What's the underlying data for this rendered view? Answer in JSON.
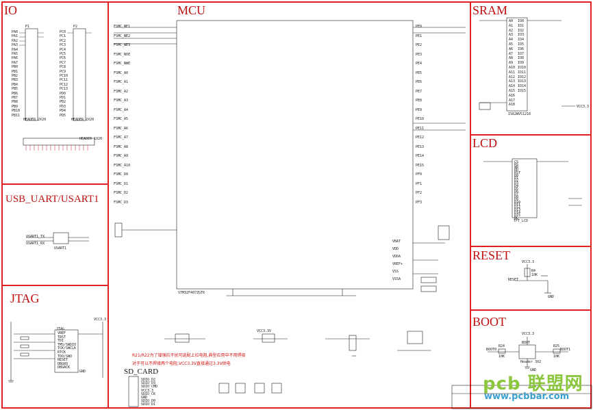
{
  "panels": {
    "io": "IO",
    "usb_uart": "USB_UART/USART1",
    "jtag": "JTAG",
    "mcu": "MCU",
    "sram": "SRAM",
    "lcd": "LCD",
    "reset": "RESET",
    "boot": "BOOT",
    "sd_card": "SD_CARD"
  },
  "io": {
    "header_left": "HEADER 2X20",
    "header_right": "HEADER 2X20",
    "p1": "P1",
    "p2": "P2",
    "header_bottom": "HEADER 1X20",
    "left_pins": [
      "PA0",
      "PA1",
      "PA2",
      "PA3",
      "PA4",
      "PA5",
      "PA6",
      "PA7",
      "PB0",
      "PB1",
      "PB2",
      "PB3",
      "PB4",
      "PB5",
      "PB6",
      "PB7",
      "PB8",
      "PB9",
      "PB10",
      "PB11"
    ],
    "right_pins": [
      "PC0",
      "PC1",
      "PC2",
      "PC3",
      "PC4",
      "PC5",
      "PC6",
      "PC7",
      "PC8",
      "PC9",
      "PC10",
      "PC11",
      "PC12",
      "PC13",
      "PD0",
      "PD1",
      "PD2",
      "PD3",
      "PD4",
      "PD5"
    ]
  },
  "usb": {
    "chip": "USART1",
    "tx": "USART1_TX",
    "rx": "USART1_RX"
  },
  "jtag": {
    "chip": "JTAG",
    "vcc": "VCC3.3",
    "pins": [
      "VREF",
      "TRST",
      "TDI",
      "TMS/SWDIO",
      "TCK/SWCLK",
      "RTCK",
      "TDO/SWO",
      "RESET",
      "DBGRQ",
      "DBGACK"
    ],
    "gnd": "GND"
  },
  "mcu": {
    "chip_name": "STM32F407ZGT6",
    "left_nets": [
      "FSMC_NE1",
      "FSMC_NE2",
      "FSMC_NE3",
      "FSMC_NOE",
      "FSMC_NWE",
      "FSMC_A0",
      "FSMC_A1",
      "FSMC_A2",
      "FSMC_A3",
      "FSMC_A4",
      "FSMC_A5",
      "FSMC_A6",
      "FSMC_A7",
      "FSMC_A8",
      "FSMC_A9",
      "FSMC_A10",
      "FSMC_D0",
      "FSMC_D1",
      "FSMC_D2",
      "FSMC_D3"
    ],
    "right_nets": [
      "PE0",
      "PE1",
      "PE2",
      "PE3",
      "PE4",
      "PE5",
      "PE6",
      "PE7",
      "PE8",
      "PE9",
      "PE10",
      "PE11",
      "PE12",
      "PE13",
      "PE14",
      "PE15",
      "PF0",
      "PF1",
      "PF2",
      "PF3"
    ],
    "power_labels": [
      "VBAT",
      "VDD",
      "VDDA",
      "VREF+",
      "VSS",
      "VSSA"
    ],
    "note1": "R21/R22为了增强抗干扰可选配上拉电阻,典型应用中不用焊接",
    "note2": "对于可以不焊接两个电阻,VCC3.3V直接通过3.3V供电",
    "vcc": "VCC3.3V"
  },
  "sram": {
    "chip": "IS62WV51216",
    "vcc": "VCC3.3",
    "address_pins": [
      "A0",
      "A1",
      "A2",
      "A3",
      "A4",
      "A5",
      "A6",
      "A7",
      "A8",
      "A9",
      "A10",
      "A11",
      "A12",
      "A13",
      "A14",
      "A15",
      "A16",
      "A17",
      "A18"
    ],
    "data_pins": [
      "IO0",
      "IO1",
      "IO2",
      "IO3",
      "IO4",
      "IO5",
      "IO6",
      "IO7",
      "IO8",
      "IO9",
      "IO10",
      "IO11",
      "IO12",
      "IO13",
      "IO14",
      "IO15"
    ]
  },
  "lcd": {
    "chip": "TFT_LCD",
    "pins": [
      "CS",
      "RS",
      "WR",
      "RD",
      "RST",
      "D0",
      "D1",
      "D2",
      "D3",
      "D4",
      "D5",
      "D6",
      "D7",
      "D8",
      "D9",
      "D10",
      "D11",
      "D12",
      "D13",
      "D14",
      "D15",
      "BL"
    ]
  },
  "reset": {
    "vcc": "VCC3.3",
    "resistor": "R4",
    "resistor_value": "10K",
    "net": "RESET",
    "gnd": "GND"
  },
  "boot": {
    "vcc": "VCC3.3",
    "chip": "BOOT",
    "header": "Header 3X2",
    "boot0": "BOOT0",
    "boot1": "BOOT1",
    "r1": "R24",
    "r2": "R25",
    "value": "10K",
    "gnd": "GND"
  },
  "sd": {
    "pins": [
      "SDIO_D2",
      "SDIO_D3",
      "SDIO_CMD",
      "VCC3.3",
      "SDIO_CK",
      "GND",
      "SDIO_D0",
      "SDIO_D1"
    ]
  },
  "logo": {
    "main": "pcb 联盟网",
    "url": "www.pcbbar.com"
  },
  "colors": {
    "panel_border": "#e02020",
    "title": "#c01010",
    "logo_green": "#8cc63f",
    "logo_blue": "#3aa0d0",
    "wire": "#1a1a1a",
    "chip_fill": "#fffbe6"
  }
}
